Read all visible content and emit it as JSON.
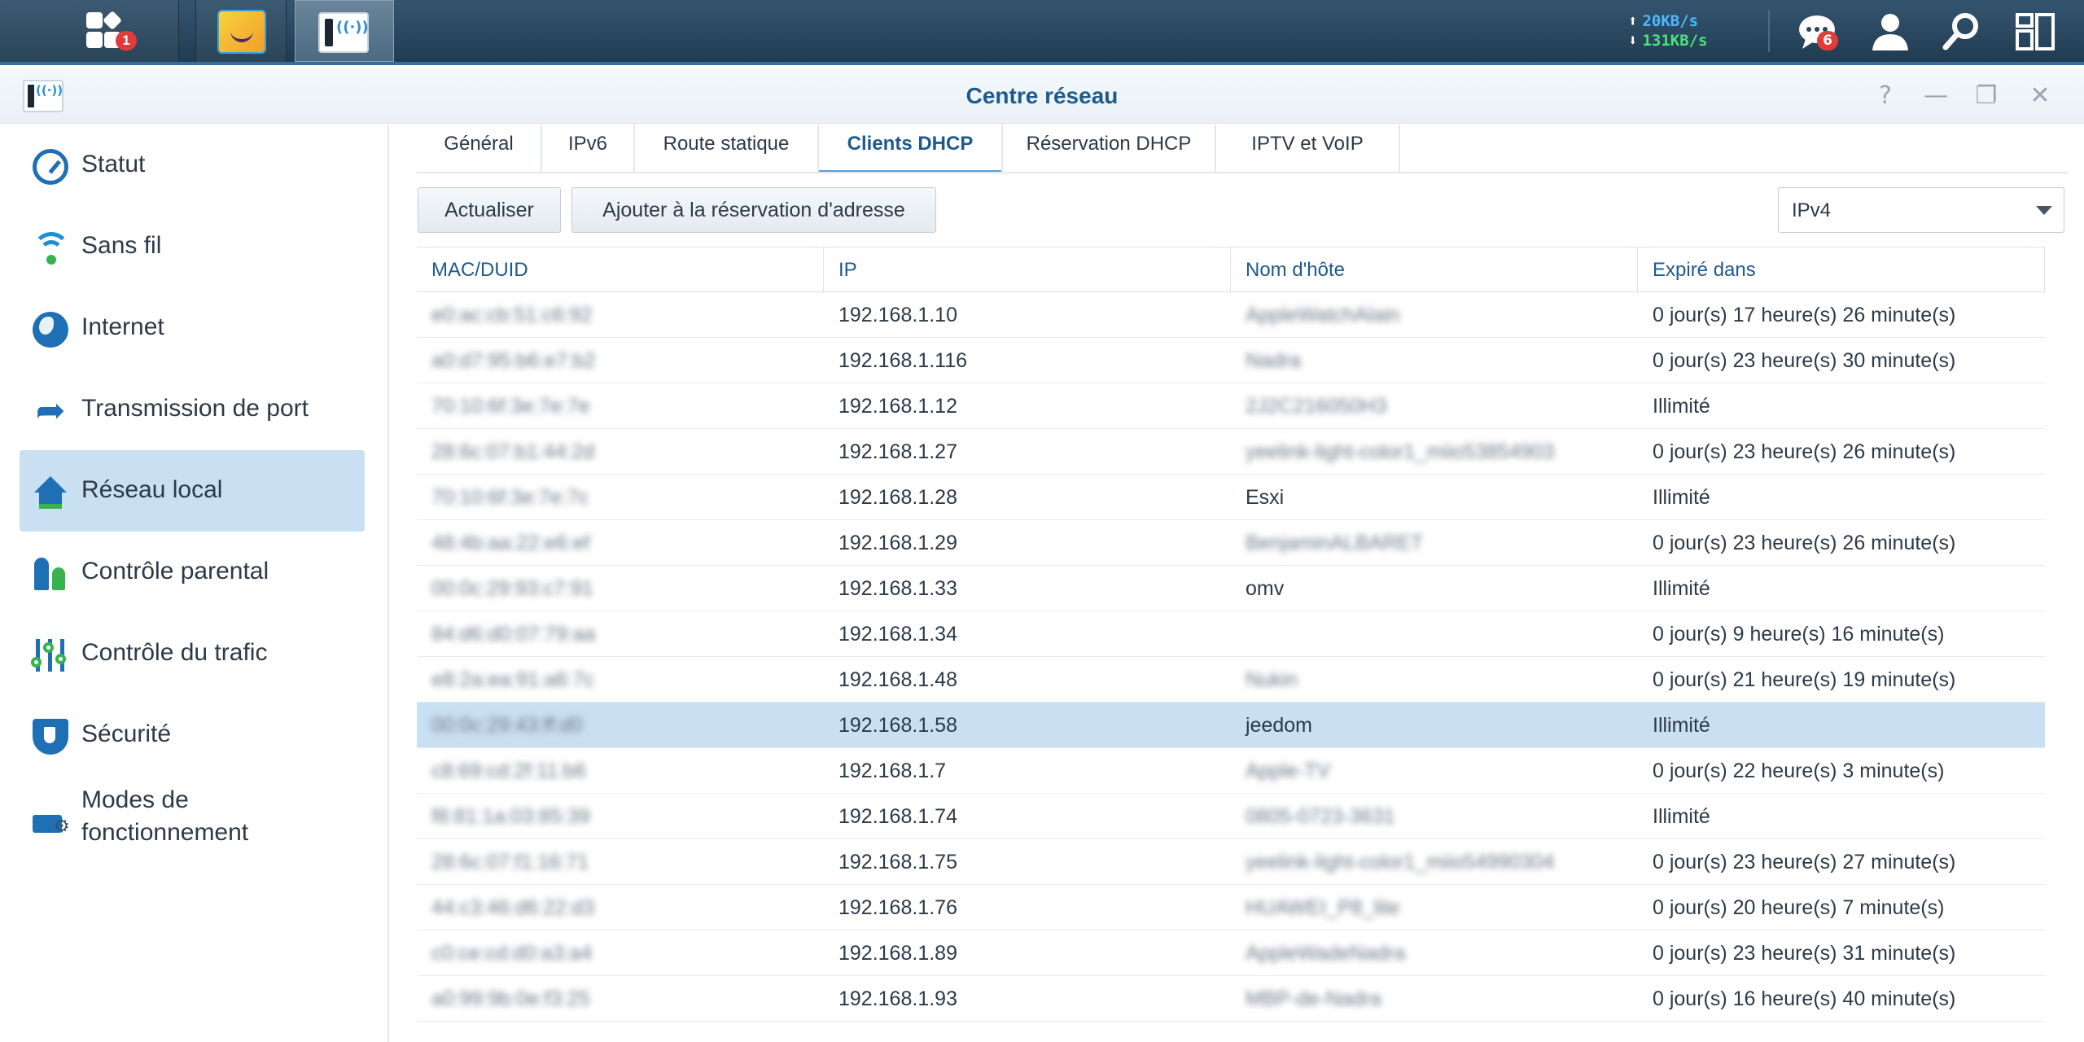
{
  "taskbar": {
    "notification_badge": "1",
    "upload_speed": "20KB/s",
    "download_speed": "131KB/s",
    "messages_badge": "6",
    "upload_arrow": "⬆",
    "download_arrow": "⬇",
    "icons": [
      "main-menu-icon",
      "package-app-icon",
      "network-center-app-icon",
      "messages-icon",
      "user-icon",
      "search-icon",
      "widgets-icon"
    ]
  },
  "window": {
    "title": "Centre réseau",
    "controls": {
      "help": "?",
      "minimize": "—",
      "restore": "❐",
      "close": "✕"
    }
  },
  "sidebar": {
    "items": [
      {
        "label": "Statut",
        "icon": "gauge-icon"
      },
      {
        "label": "Sans fil",
        "icon": "wifi-icon"
      },
      {
        "label": "Internet",
        "icon": "globe-icon"
      },
      {
        "label": "Transmission de port",
        "icon": "forward-arrow-icon"
      },
      {
        "label": "Réseau local",
        "icon": "home-network-icon",
        "active": true
      },
      {
        "label": "Contrôle parental",
        "icon": "family-icon"
      },
      {
        "label": "Contrôle du trafic",
        "icon": "sliders-icon"
      },
      {
        "label": "Sécurité",
        "icon": "shield-icon"
      },
      {
        "label": "Modes de",
        "label2": "fonctionnement",
        "icon": "router-settings-icon"
      }
    ]
  },
  "tabs": [
    {
      "label": "Général"
    },
    {
      "label": "IPv6"
    },
    {
      "label": "Route statique"
    },
    {
      "label": "Clients DHCP",
      "active": true
    },
    {
      "label": "Réservation DHCP"
    },
    {
      "label": "IPTV et VoIP"
    }
  ],
  "toolbar": {
    "refresh_label": "Actualiser",
    "add_reservation_label": "Ajouter à la réservation d'adresse",
    "ip_version": "IPv4"
  },
  "table": {
    "columns": [
      "MAC/DUID",
      "IP",
      "Nom d'hôte",
      "Expiré dans"
    ],
    "rows": [
      {
        "mac": "e0:ac:cb:51:c6:92",
        "ip": "192.168.1.10",
        "host": "AppleWatchAlain",
        "expires": "0 jour(s) 17 heure(s) 26 minute(s)",
        "host_blurred": true
      },
      {
        "mac": "a0:d7:95:b6:e7:b2",
        "ip": "192.168.1.116",
        "host": "Nadra",
        "expires": "0 jour(s) 23 heure(s) 30 minute(s)",
        "host_blurred": true
      },
      {
        "mac": "70:10:6f:3e:7e:7e",
        "ip": "192.168.1.12",
        "host": "2J2C216050H3",
        "expires": "Illimité",
        "host_blurred": true
      },
      {
        "mac": "28:6c:07:b1:44:2d",
        "ip": "192.168.1.27",
        "host": "yeelink-light-color1_miio53854903",
        "expires": "0 jour(s) 23 heure(s) 26 minute(s)",
        "host_blurred": true
      },
      {
        "mac": "70:10:6f:3e:7e:7c",
        "ip": "192.168.1.28",
        "host": "Esxi",
        "expires": "Illimité",
        "host_blurred": false
      },
      {
        "mac": "48:4b:aa:22:e6:ef",
        "ip": "192.168.1.29",
        "host": "BenjaminALBARET",
        "expires": "0 jour(s) 23 heure(s) 26 minute(s)",
        "host_blurred": true
      },
      {
        "mac": "00:0c:29:93:c7:91",
        "ip": "192.168.1.33",
        "host": "omv",
        "expires": "Illimité",
        "host_blurred": false
      },
      {
        "mac": "84:d6:d0:07:79:aa",
        "ip": "192.168.1.34",
        "host": "",
        "expires": "0 jour(s) 9 heure(s) 16 minute(s)",
        "host_blurred": false
      },
      {
        "mac": "e8:2a:ea:91:a6:7c",
        "ip": "192.168.1.48",
        "host": "Nukin",
        "expires": "0 jour(s) 21 heure(s) 19 minute(s)",
        "host_blurred": true
      },
      {
        "mac": "00:0c:29:43:ff:d0",
        "ip": "192.168.1.58",
        "host": "jeedom",
        "expires": "Illimité",
        "host_blurred": false,
        "selected": true
      },
      {
        "mac": "c8:69:cd:2f:11:b6",
        "ip": "192.168.1.7",
        "host": "Apple-TV",
        "expires": "0 jour(s) 22 heure(s) 3 minute(s)",
        "host_blurred": true
      },
      {
        "mac": "f8:81:1a:03:85:39",
        "ip": "192.168.1.74",
        "host": "0805-0723-3631",
        "expires": "Illimité",
        "host_blurred": true
      },
      {
        "mac": "28:6c:07:f1:16:71",
        "ip": "192.168.1.75",
        "host": "yeelink-light-color1_miio54990304",
        "expires": "0 jour(s) 23 heure(s) 27 minute(s)",
        "host_blurred": true
      },
      {
        "mac": "44:c3:46:d6:22:d3",
        "ip": "192.168.1.76",
        "host": "HUAWEI_P8_lite",
        "expires": "0 jour(s) 20 heure(s) 7 minute(s)",
        "host_blurred": true
      },
      {
        "mac": "c0:ce:cd:d0:a3:a4",
        "ip": "192.168.1.89",
        "host": "AppleWadeNadra",
        "expires": "0 jour(s) 23 heure(s) 31 minute(s)",
        "host_blurred": true
      },
      {
        "mac": "a0:99:9b:0e:f3:25",
        "ip": "192.168.1.93",
        "host": "MBP-de-Nadra",
        "expires": "0 jour(s) 16 heure(s) 40 minute(s)",
        "host_blurred": true
      }
    ]
  },
  "colors": {
    "accent": "#1e5a8c",
    "selection": "#c9dff2",
    "taskbar": "#2a4559"
  }
}
